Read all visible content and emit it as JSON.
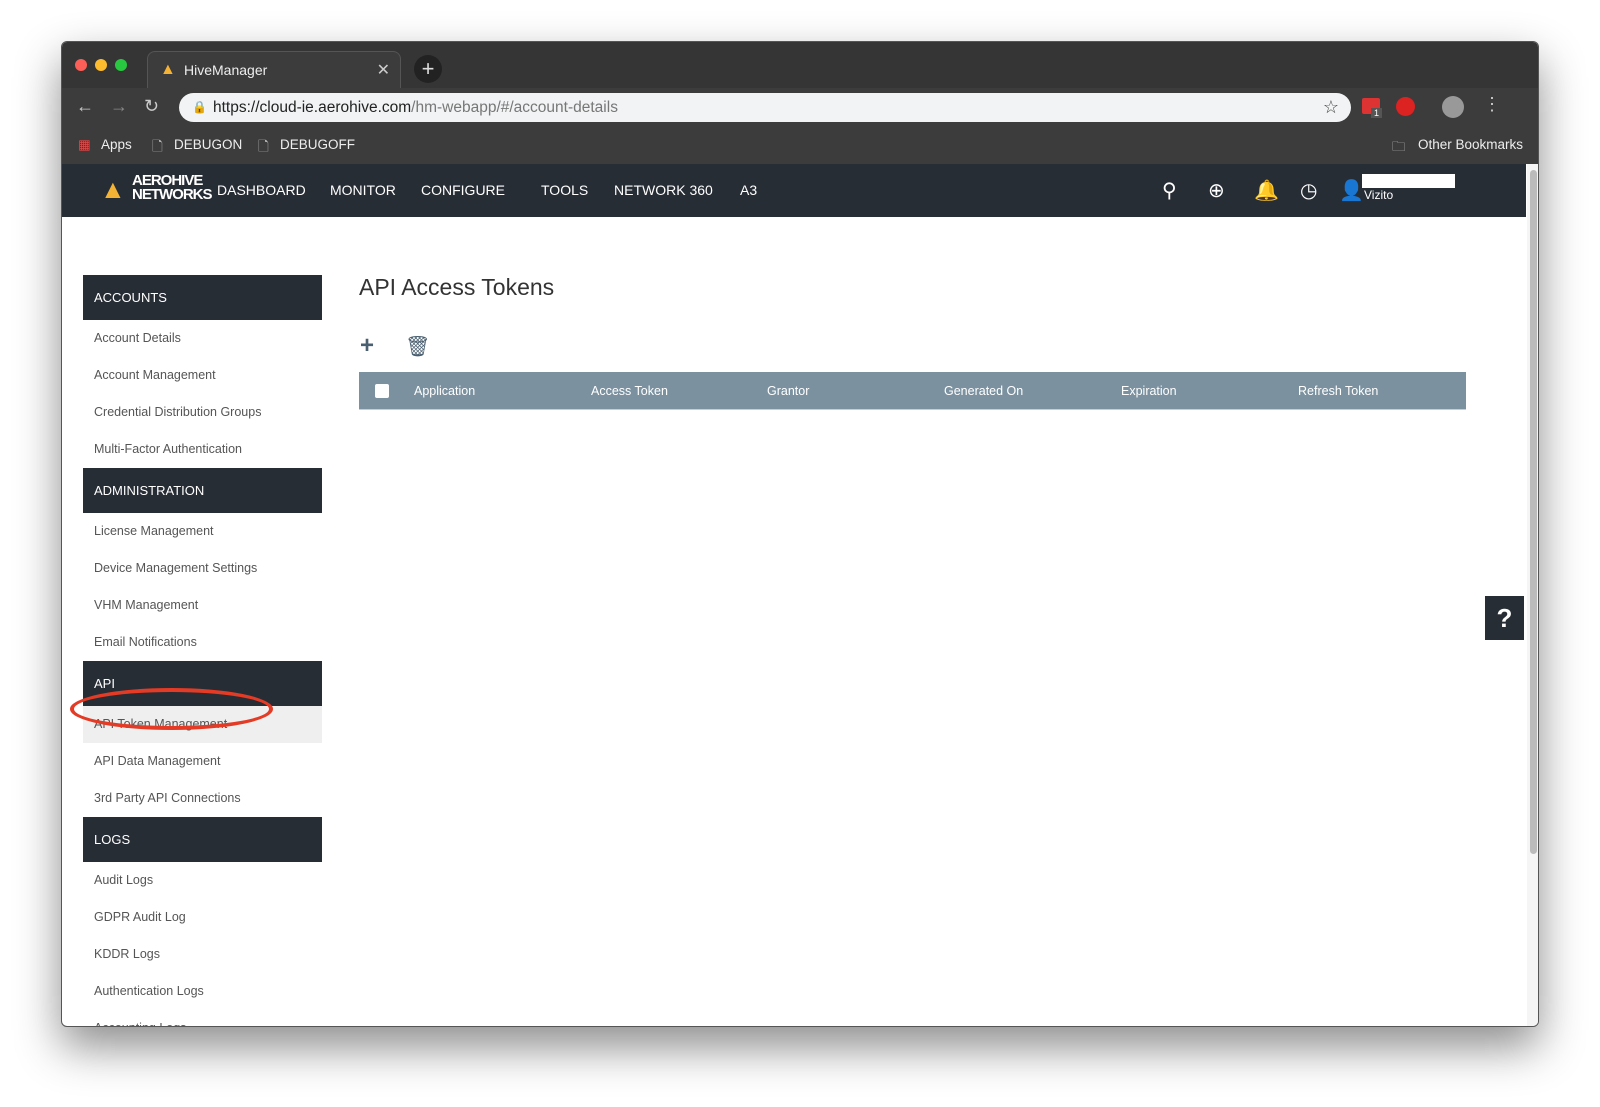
{
  "browser": {
    "tab_title": "HiveManager",
    "url_host": "https://cloud-ie.aerohive.com",
    "url_path": "/hm-webapp/#/account-details",
    "bookmarks": [
      "Apps",
      "DEBUGON",
      "DEBUGOFF"
    ],
    "other_bookmarks": "Other Bookmarks",
    "extension_badge": "1"
  },
  "header": {
    "logo": "AEROHIVE NETWORKS",
    "menu": [
      "DASHBOARD",
      "MONITOR",
      "CONFIGURE",
      "TOOLS",
      "NETWORK 360",
      "A3"
    ],
    "user": "Vizito"
  },
  "sidebar": [
    {
      "title": "ACCOUNTS",
      "items": [
        "Account Details",
        "Account Management",
        "Credential Distribution Groups",
        "Multi-Factor Authentication"
      ]
    },
    {
      "title": "ADMINISTRATION",
      "items": [
        "License Management",
        "Device Management Settings",
        "VHM Management",
        "Email Notifications"
      ]
    },
    {
      "title": "API",
      "items": [
        "API Token Management",
        "API Data Management",
        "3rd Party API Connections"
      ]
    },
    {
      "title": "LOGS",
      "items": [
        "Audit Logs",
        "GDPR Audit Log",
        "KDDR Logs",
        "Authentication Logs",
        "Accounting Logs"
      ]
    }
  ],
  "selected_item": "API Token Management",
  "main": {
    "title": "API Access Tokens",
    "columns": [
      "Application",
      "Access Token",
      "Grantor",
      "Generated On",
      "Expiration",
      "Refresh Token"
    ]
  },
  "help": "?",
  "colors": {
    "header": "#272d35",
    "table_header": "#7b919f",
    "highlight": "#e33b25",
    "brand": "#f5b335"
  }
}
